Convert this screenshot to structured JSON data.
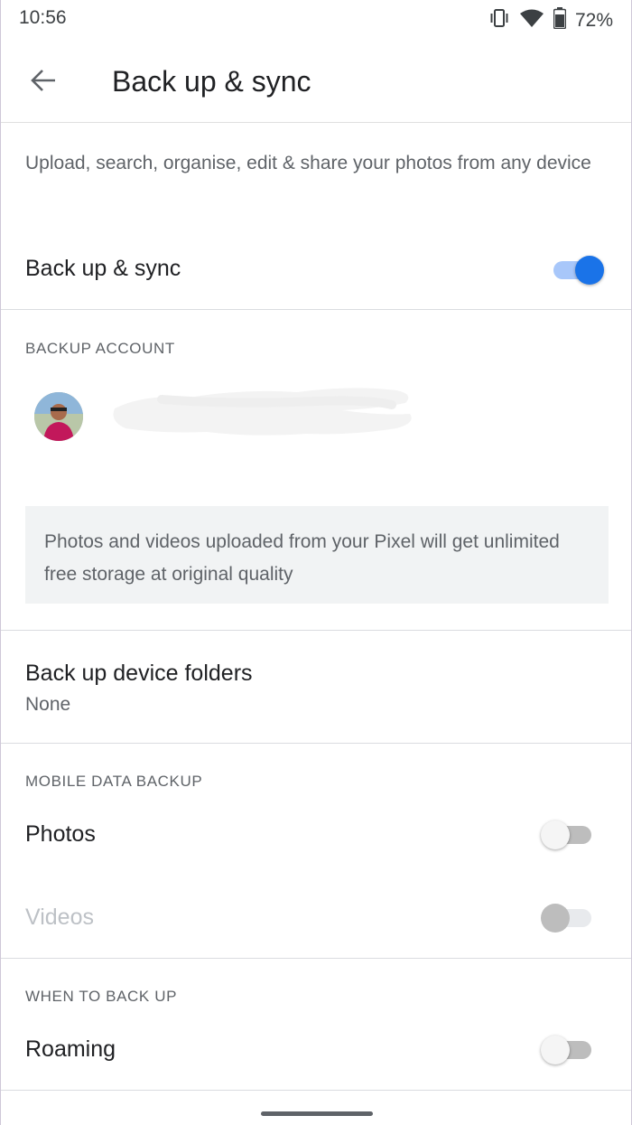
{
  "status_bar": {
    "time": "10:56",
    "battery_percent": "72%",
    "icons": [
      "vibrate-icon",
      "wifi-icon",
      "battery-icon"
    ]
  },
  "app_bar": {
    "back_icon": "arrow-back-icon",
    "title": "Back up & sync"
  },
  "description": "Upload, search, organise, edit & share your photos from any device",
  "backup_sync": {
    "label": "Back up & sync",
    "enabled": true
  },
  "backup_account": {
    "header": "BACKUP ACCOUNT",
    "avatar_icon": "avatar",
    "info": "Photos and videos uploaded from your Pixel will get unlimited free storage at original quality"
  },
  "device_folders": {
    "label": "Back up device folders",
    "value": "None"
  },
  "mobile_data_backup": {
    "header": "MOBILE DATA BACKUP",
    "photos_label": "Photos",
    "photos_enabled": false,
    "videos_label": "Videos",
    "videos_enabled": false
  },
  "when_to_back_up": {
    "header": "WHEN TO BACK UP",
    "roaming_label": "Roaming",
    "roaming_enabled": false
  },
  "colors": {
    "accent": "#1a73e8",
    "accent_track": "#a8c7fa",
    "text_primary": "#202124",
    "text_secondary": "#5f6368"
  }
}
